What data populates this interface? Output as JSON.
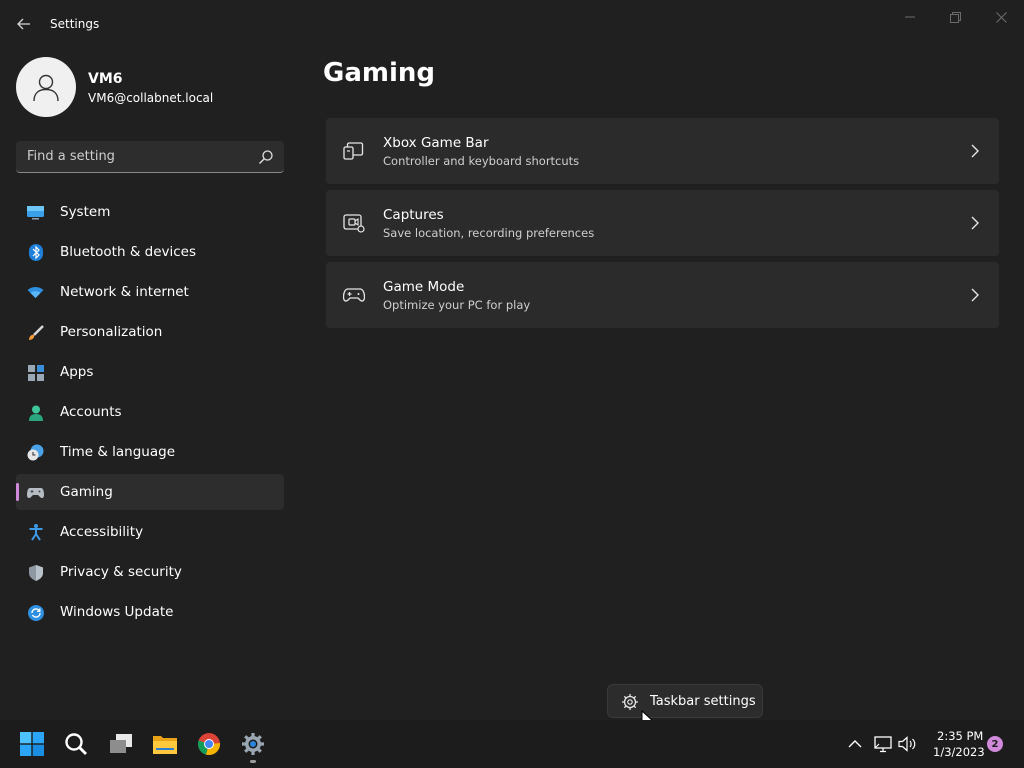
{
  "window": {
    "title": "Settings"
  },
  "profile": {
    "name": "VM6",
    "email": "VM6@collabnet.local"
  },
  "search": {
    "placeholder": "Find a setting"
  },
  "nav": {
    "selected": "Gaming",
    "items": [
      {
        "label": "System",
        "icon": "monitor-icon"
      },
      {
        "label": "Bluetooth & devices",
        "icon": "bluetooth-icon"
      },
      {
        "label": "Network & internet",
        "icon": "wifi-icon"
      },
      {
        "label": "Personalization",
        "icon": "brush-icon"
      },
      {
        "label": "Apps",
        "icon": "apps-icon"
      },
      {
        "label": "Accounts",
        "icon": "person-icon"
      },
      {
        "label": "Time & language",
        "icon": "clock-globe-icon"
      },
      {
        "label": "Gaming",
        "icon": "gamepad-icon"
      },
      {
        "label": "Accessibility",
        "icon": "accessibility-icon"
      },
      {
        "label": "Privacy & security",
        "icon": "shield-icon"
      },
      {
        "label": "Windows Update",
        "icon": "update-icon"
      }
    ]
  },
  "page": {
    "title": "Gaming",
    "cards": [
      {
        "title": "Xbox Game Bar",
        "subtitle": "Controller and keyboard shortcuts",
        "icon": "game-bar-icon"
      },
      {
        "title": "Captures",
        "subtitle": "Save location, recording preferences",
        "icon": "capture-icon"
      },
      {
        "title": "Game Mode",
        "subtitle": "Optimize your PC for play",
        "icon": "controller-icon"
      }
    ]
  },
  "context_menu": {
    "label": "Taskbar settings",
    "icon": "gear-icon"
  },
  "taskbar": {
    "time": "2:35 PM",
    "date": "1/3/2023",
    "notification_count": "2"
  },
  "colors": {
    "accent": "#d08ad9",
    "background": "#202020",
    "card": "#2b2b2b"
  }
}
